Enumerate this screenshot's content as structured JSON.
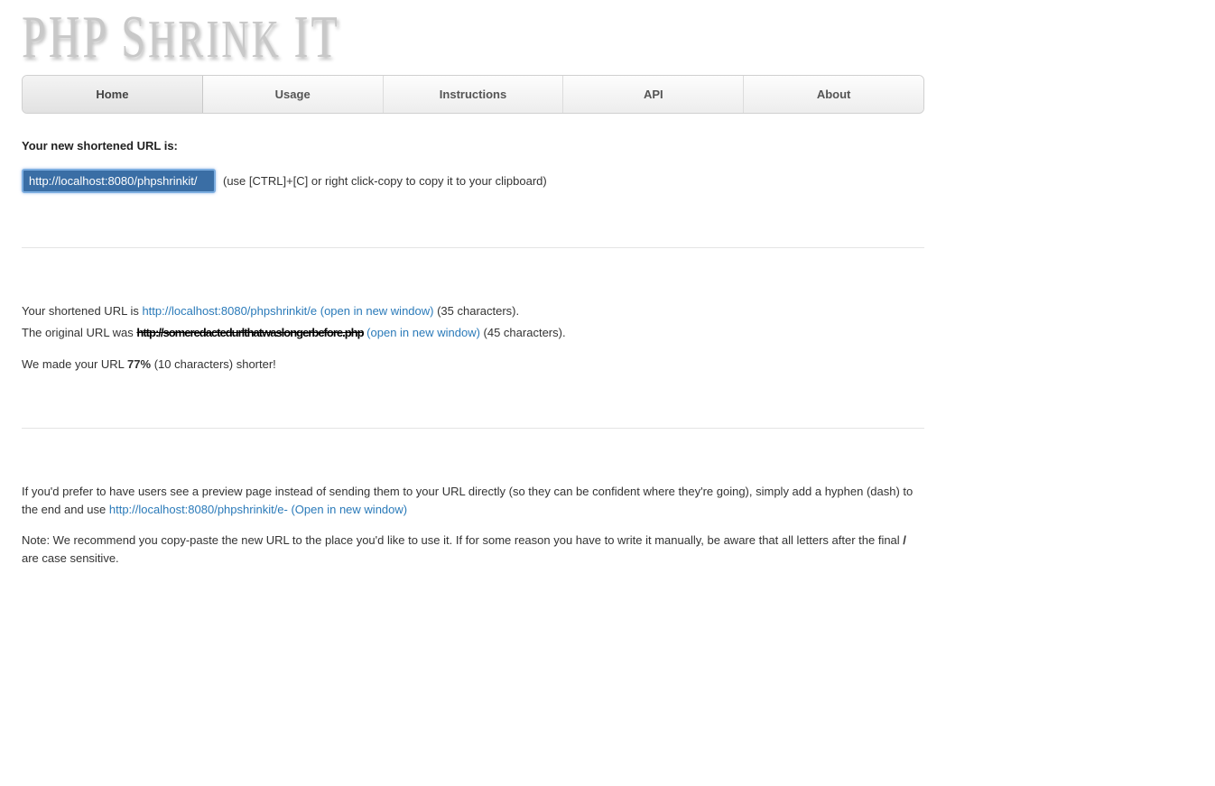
{
  "logo": {
    "line1_a": "PHP S",
    "line1_b": "HRINK ",
    "line1_c": "IT"
  },
  "nav": {
    "items": [
      {
        "label": "Home",
        "active": true
      },
      {
        "label": "Usage",
        "active": false
      },
      {
        "label": "Instructions",
        "active": false
      },
      {
        "label": "API",
        "active": false
      },
      {
        "label": "About",
        "active": false
      }
    ]
  },
  "result": {
    "heading": "Your new shortened URL is:",
    "url_value": "http://localhost:8080/phpshrinkit/",
    "copy_hint": "(use [CTRL]+[C] or right click-copy to copy it to your clipboard)"
  },
  "summary": {
    "shortened_prefix": "Your shortened URL is ",
    "shortened_link": "http://localhost:8080/phpshrinkit/e (open in new window)",
    "shortened_suffix": " (35 characters).",
    "original_prefix": "The original URL was ",
    "original_strike": "http://someredactedurlthatwaslongerbefore.php",
    "original_link": " (open in new window)",
    "original_suffix": " (45 characters).",
    "saved_prefix": "We made your URL ",
    "saved_percent": "77%",
    "saved_suffix": " (10 characters) shorter!"
  },
  "preview": {
    "text_before": "If you'd prefer to have users see a preview page instead of sending them to your URL directly (so they can be confident where they're going), simply add a hyphen (dash) to the end and use ",
    "link": "http://localhost:8080/phpshrinkit/e- (Open in new window)"
  },
  "note": {
    "prefix": "Note: We recommend you copy-paste the new URL to the place you'd like to use it. If for some reason you have to write it manually, be aware that all letters after the final ",
    "slash": "/",
    "suffix": " are case sensitive."
  }
}
